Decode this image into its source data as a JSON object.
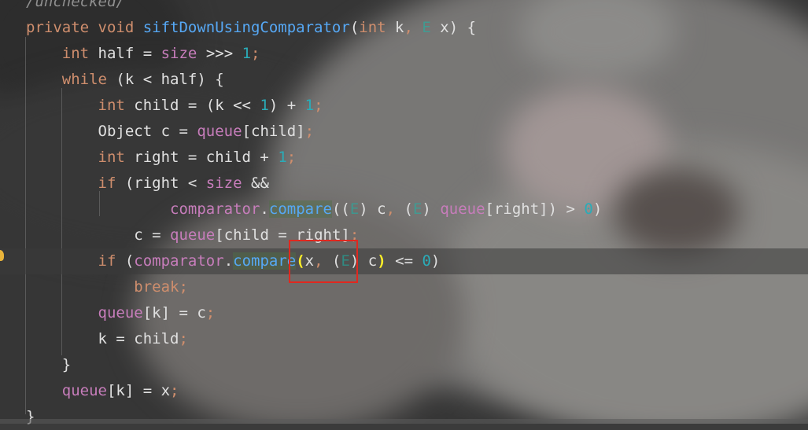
{
  "editor": {
    "language": "java",
    "lines": [
      {
        "indent": "",
        "tokens": [
          [
            "cmt",
            "/unchecked/"
          ]
        ]
      },
      {
        "indent": "",
        "tokens": [
          [
            "kw",
            "private "
          ],
          [
            "kw",
            "void "
          ],
          [
            "fn",
            "siftDownUsingComparator"
          ],
          [
            "plain",
            "("
          ],
          [
            "kw",
            "int "
          ],
          [
            "plain",
            "k"
          ],
          [
            "punc",
            ", "
          ],
          [
            "typ",
            "E "
          ],
          [
            "plain",
            "x) {"
          ]
        ]
      },
      {
        "indent": "    ",
        "tokens": [
          [
            "kw",
            "int "
          ],
          [
            "plain",
            "half = "
          ],
          [
            "fld",
            "size"
          ],
          [
            "plain",
            " >>> "
          ],
          [
            "num",
            "1"
          ],
          [
            "punc",
            ";"
          ]
        ]
      },
      {
        "indent": "    ",
        "tokens": [
          [
            "kw",
            "while "
          ],
          [
            "plain",
            "(k < half) {"
          ]
        ]
      },
      {
        "indent": "        ",
        "tokens": [
          [
            "kw",
            "int "
          ],
          [
            "plain",
            "child = (k << "
          ],
          [
            "num",
            "1"
          ],
          [
            "plain",
            ") + "
          ],
          [
            "num",
            "1"
          ],
          [
            "punc",
            ";"
          ]
        ]
      },
      {
        "indent": "        ",
        "tokens": [
          [
            "plain",
            "Object c = "
          ],
          [
            "fld",
            "queue"
          ],
          [
            "plain",
            "[child]"
          ],
          [
            "punc",
            ";"
          ]
        ]
      },
      {
        "indent": "        ",
        "tokens": [
          [
            "kw",
            "int "
          ],
          [
            "plain",
            "right = child + "
          ],
          [
            "num",
            "1"
          ],
          [
            "punc",
            ";"
          ]
        ]
      },
      {
        "indent": "        ",
        "tokens": [
          [
            "kw",
            "if "
          ],
          [
            "plain",
            "(right < "
          ],
          [
            "fld",
            "size"
          ],
          [
            "plain",
            " &&"
          ]
        ]
      },
      {
        "indent": "                ",
        "tokens": [
          [
            "fld",
            "comparator"
          ],
          [
            "plain",
            "."
          ],
          [
            "method",
            "compare"
          ],
          [
            "plain",
            "(("
          ],
          [
            "typ",
            "E"
          ],
          [
            "plain",
            ") c"
          ],
          [
            "punc",
            ", "
          ],
          [
            "plain",
            "("
          ],
          [
            "typ",
            "E"
          ],
          [
            "plain",
            ") "
          ],
          [
            "fld",
            "queue"
          ],
          [
            "plain",
            "[right]) > "
          ],
          [
            "num",
            "0"
          ],
          [
            "plain",
            ")"
          ]
        ]
      },
      {
        "indent": "            ",
        "tokens": [
          [
            "plain",
            "c = "
          ],
          [
            "fld",
            "queue"
          ],
          [
            "plain",
            "[child = right]"
          ],
          [
            "punc",
            ";"
          ]
        ]
      },
      {
        "indent": "        ",
        "highlight": true,
        "tokens": [
          [
            "kw",
            "if "
          ],
          [
            "plain",
            "("
          ],
          [
            "fld",
            "comparator"
          ],
          [
            "plain",
            "."
          ],
          [
            "method",
            "compare"
          ],
          [
            "brace",
            "("
          ],
          [
            "plain",
            "x"
          ],
          [
            "punc",
            ", "
          ],
          [
            "plain",
            "("
          ],
          [
            "typ",
            "E"
          ],
          [
            "plain",
            ") c"
          ],
          [
            "brace",
            ")"
          ],
          [
            "plain",
            " <= "
          ],
          [
            "num",
            "0"
          ],
          [
            "plain",
            ")"
          ]
        ]
      },
      {
        "indent": "            ",
        "tokens": [
          [
            "kw",
            "break"
          ],
          [
            "punc",
            ";"
          ]
        ]
      },
      {
        "indent": "        ",
        "tokens": [
          [
            "fld",
            "queue"
          ],
          [
            "plain",
            "[k] = c"
          ],
          [
            "punc",
            ";"
          ]
        ]
      },
      {
        "indent": "        ",
        "tokens": [
          [
            "plain",
            "k = child"
          ],
          [
            "punc",
            ";"
          ]
        ]
      },
      {
        "indent": "    ",
        "tokens": [
          [
            "plain",
            "}"
          ]
        ]
      },
      {
        "indent": "    ",
        "tokens": [
          [
            "fld",
            "queue"
          ],
          [
            "plain",
            "[k] = x"
          ],
          [
            "punc",
            ";"
          ]
        ]
      },
      {
        "indent": "",
        "tokens": [
          [
            "plain",
            "}"
          ]
        ]
      }
    ]
  },
  "icons": {
    "gutter": "lightbulb-icon"
  },
  "colors": {
    "annotation_box": "#e0281f"
  }
}
